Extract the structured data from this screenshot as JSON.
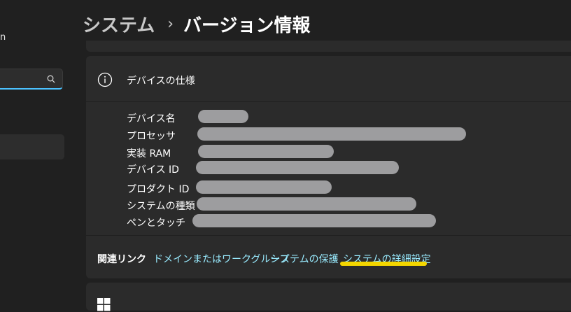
{
  "sidebar": {
    "user_name_fragment": "n",
    "search": {
      "placeholder": ""
    }
  },
  "breadcrumb": {
    "parent": "システム",
    "separator": "›",
    "current": "バージョン情報"
  },
  "device_specs": {
    "title": "デバイスの仕様",
    "rows": [
      {
        "label": "デバイス名"
      },
      {
        "label": "プロセッサ"
      },
      {
        "label": "実装 RAM"
      },
      {
        "label": "デバイス ID"
      },
      {
        "label": "プロダクト ID"
      },
      {
        "label": "システムの種類"
      },
      {
        "label": "ペンとタッチ"
      }
    ]
  },
  "related": {
    "label": "関連リンク",
    "links": [
      "ドメインまたはワークグループ",
      "システムの保護",
      "システムの詳細設定"
    ]
  },
  "colors": {
    "background": "#202020",
    "card": "#2b2b2b",
    "link": "#99ebff",
    "accent": "#4cc2ff",
    "highlight": "#f3d600"
  }
}
